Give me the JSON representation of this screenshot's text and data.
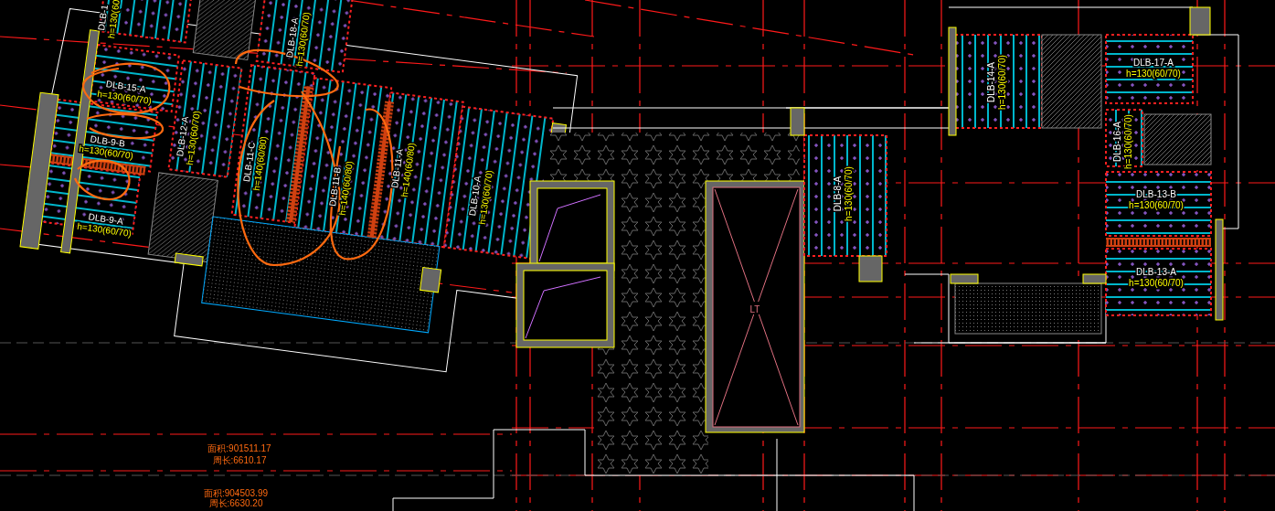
{
  "drawing": {
    "slabs": [
      {
        "kind": "vertical",
        "label": "DLB-1",
        "thickness": "h=130(60"
      },
      {
        "kind": "horizontal",
        "label": "DLB-15-A",
        "thickness": "h=130(60/70)"
      },
      {
        "kind": "vertical",
        "label": "DLB-12-A",
        "thickness": "h=130(60/70)"
      },
      {
        "kind": "vertical",
        "label": "DLB-18-A",
        "thickness": "h=130(60/70)"
      },
      {
        "kind": "vertical",
        "label": "DLB-11-C",
        "thickness": "h=140(60/80)"
      },
      {
        "kind": "vertical",
        "label": "DLB-11-B",
        "thickness": "h=140(60/80)"
      },
      {
        "kind": "vertical",
        "label": "DLB-11-A",
        "thickness": "h=140(60/80)"
      },
      {
        "kind": "vertical",
        "label": "DLB-10-A",
        "thickness": "h=130(60/70)"
      },
      {
        "kind": "horizontal",
        "label": "DLB-9-B",
        "thickness": "h=130(60/70)"
      },
      {
        "kind": "horizontal",
        "label": "DLB-9-A",
        "thickness": "h=130(60/70)"
      },
      {
        "kind": "vertical",
        "label": "DLB-14-A",
        "thickness": "h=130(60/70)"
      },
      {
        "kind": "horizontal",
        "label": "DLB-17-A",
        "thickness": "h=130(60/70)"
      },
      {
        "kind": "vertical",
        "label": "DLB-16-A",
        "thickness": "h=130(60/70)"
      },
      {
        "kind": "vertical",
        "label": "DLB-8-A",
        "thickness": "h=130(60/70)"
      },
      {
        "kind": "horizontal",
        "label": "DLB-13-B",
        "thickness": "h=130(60/70)"
      },
      {
        "kind": "horizontal",
        "label": "DLB-13-A",
        "thickness": "h=130(60/70)"
      }
    ],
    "elevator": {
      "label": "LT"
    },
    "area_notes": [
      {
        "area": "面积:901511.17",
        "perimeter": "周长:6610.17"
      },
      {
        "area": "面积:904503.99",
        "perimeter": "周长:6630.20"
      }
    ]
  }
}
